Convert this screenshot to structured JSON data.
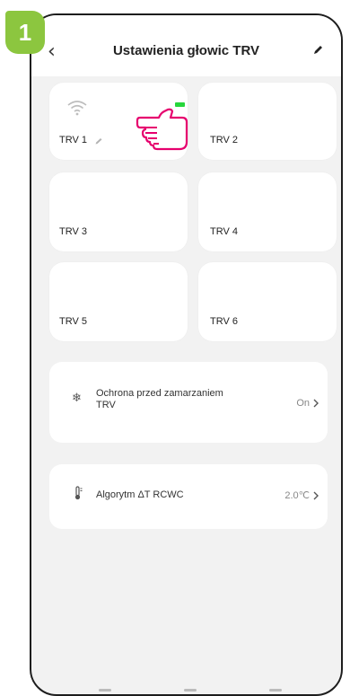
{
  "step": {
    "number": "1",
    "color": "#8cc63f"
  },
  "header": {
    "title": "Ustawienia głowic TRV",
    "back_icon": "chevron-left-icon",
    "edit_icon": "pencil-icon"
  },
  "trv_tiles": [
    {
      "label": "TRV 1",
      "has_wifi": true,
      "battery_color": "#27d63b"
    },
    {
      "label": "TRV 2"
    },
    {
      "label": "TRV 3"
    },
    {
      "label": "TRV 4"
    },
    {
      "label": "TRV 5"
    },
    {
      "label": "TRV 6"
    }
  ],
  "settings": [
    {
      "icon": "snowflake-icon",
      "label": "Ochrona przed zamarzaniem TRV",
      "value": "On"
    },
    {
      "icon": "thermometer-icon",
      "label": "Algorytm ΔT RCWC",
      "value": "2.0℃"
    }
  ],
  "accent": {
    "hand_pointer": "#e6006e"
  }
}
